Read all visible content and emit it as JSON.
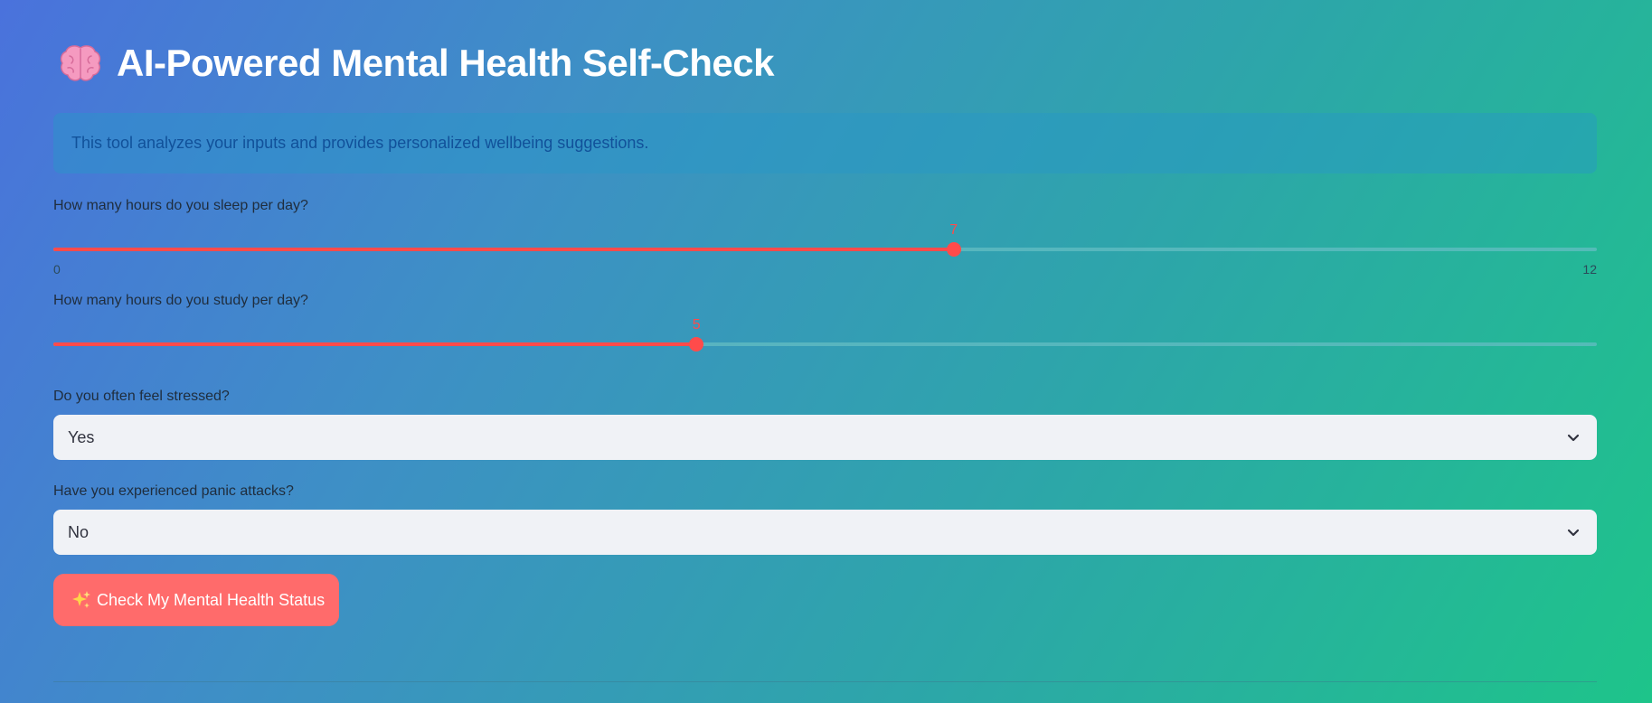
{
  "header": {
    "title": "AI-Powered Mental Health Self-Check",
    "icon": "brain-icon"
  },
  "info": {
    "text": "This tool analyzes your inputs and provides personalized wellbeing suggestions."
  },
  "sleep_slider": {
    "label": "How many hours do you sleep per day?",
    "min": 0,
    "max": 12,
    "value": 7,
    "min_label": "0",
    "max_label": "12",
    "value_label": "7"
  },
  "study_slider": {
    "label": "How many hours do you study per day?",
    "min": 0,
    "max": 12,
    "value": 5,
    "value_label": "5"
  },
  "stress_select": {
    "label": "Do you often feel stressed?",
    "value": "Yes"
  },
  "panic_select": {
    "label": "Have you experienced panic attacks?",
    "value": "No"
  },
  "check_button": {
    "label": "Check My Mental Health Status",
    "icon": "sparkles-icon"
  },
  "colors": {
    "accent": "#ff4b4b",
    "button": "#ff6b6b",
    "select_bg": "#f0f2f6",
    "info_text": "#11519a"
  }
}
